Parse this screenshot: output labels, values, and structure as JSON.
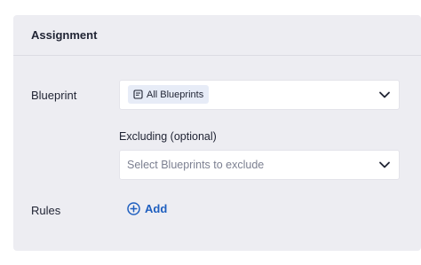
{
  "panel": {
    "title": "Assignment"
  },
  "blueprint": {
    "label": "Blueprint",
    "chip_label": "All Blueprints",
    "chip_icon": "blueprint-icon",
    "chevron_icon": "chevron-down-icon"
  },
  "excluding": {
    "label": "Excluding (optional)",
    "placeholder": "Select Blueprints to exclude",
    "chevron_icon": "chevron-down-icon"
  },
  "rules": {
    "label": "Rules",
    "add_label": "Add",
    "add_icon": "plus-circle-icon"
  },
  "colors": {
    "panel_bg": "#ededf2",
    "link": "#1f5fbf",
    "chip_bg": "#e7ecf7",
    "text": "#1f2333",
    "placeholder": "#7c8091"
  }
}
